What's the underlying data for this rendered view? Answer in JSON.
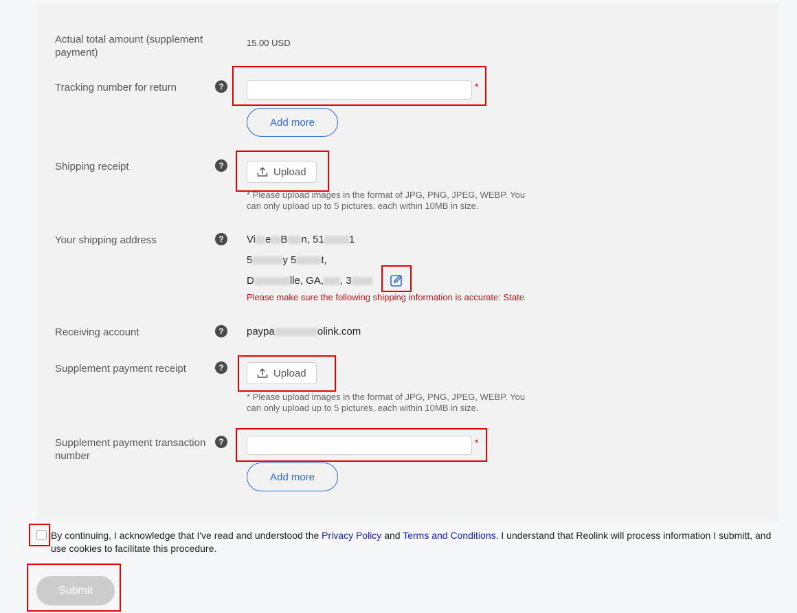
{
  "form": {
    "actual_total": {
      "label": "Actual total amount (supplement payment)",
      "value": "15.00 USD"
    },
    "tracking": {
      "label": "Tracking number for return",
      "help": "?",
      "value": "",
      "placeholder": "",
      "required_mark": "*",
      "add_more_label": "Add more"
    },
    "shipping_receipt": {
      "label": "Shipping receipt",
      "help": "?",
      "upload_label": "Upload",
      "hint": "* Please upload images in the format of JPG, PNG, JPEG, WEBP. You can only upload up to 5 pictures, each within 10MB in size."
    },
    "shipping_address": {
      "label": "Your shipping address",
      "help": "?",
      "line1_a": "Vi",
      "line1_b": "e",
      "line1_c": "B",
      "line1_d": "n, 51",
      "line1_e": "1",
      "line2_a": "5",
      "line2_b": "y 5",
      "line2_c": "t,",
      "line3_a": "D",
      "line3_b": "lle, GA,",
      "line3_c": ", 3",
      "warning": "Please make sure the following shipping information is accurate: State"
    },
    "receiving_account": {
      "label": "Receiving account",
      "help": "?",
      "value_a": "paypa",
      "value_b": "olink.com"
    },
    "supplement_receipt": {
      "label": "Supplement payment receipt",
      "help": "?",
      "upload_label": "Upload",
      "hint": "* Please upload images in the format of JPG, PNG, JPEG, WEBP. You can only upload up to 5 pictures, each within 10MB in size."
    },
    "transaction_number": {
      "label": "Supplement payment transaction number",
      "help": "?",
      "value": "",
      "placeholder": "",
      "required_mark": "*",
      "add_more_label": "Add more"
    }
  },
  "consent": {
    "checked": false,
    "text_before": "By continuing, I acknowledge that I've read and understood the ",
    "privacy_link": "Privacy Policy",
    "text_and": " and ",
    "terms_link": "Terms and Conditions",
    "text_after": ". I understand that Reolink will process information I submitt, and use cookies to facilitate this procedure."
  },
  "submit_label": "Submit",
  "colors": {
    "accent": "#2a6bd8",
    "warning": "#c0101a",
    "highlight": "#e60000",
    "disabled": "#cccccc"
  }
}
